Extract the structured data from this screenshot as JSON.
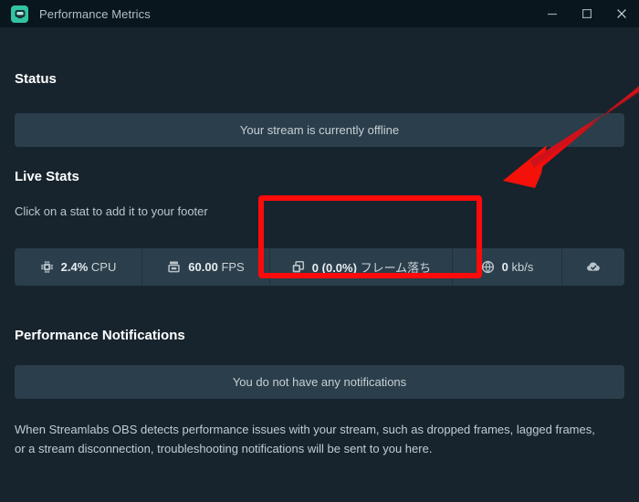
{
  "window": {
    "title": "Performance Metrics",
    "app_icon": "streamlabs-obs-icon",
    "controls": {
      "minimize": "minimize-icon",
      "maximize": "maximize-icon",
      "close": "close-icon"
    }
  },
  "sections": {
    "status": {
      "heading": "Status",
      "message": "Your stream is currently offline"
    },
    "live_stats": {
      "heading": "Live Stats",
      "hint": "Click on a stat to add it to your footer",
      "stats": [
        {
          "icon": "cpu-chip-icon",
          "value": "2.4%",
          "unit": "CPU"
        },
        {
          "icon": "layers-stack-icon",
          "value": "60.00",
          "unit": "FPS"
        },
        {
          "icon": "duplicate-frames-icon",
          "value": "0 (0.0%)",
          "unit": "フレーム落ち"
        },
        {
          "icon": "bandwidth-globe-icon",
          "value": "0",
          "unit": "kb/s"
        },
        {
          "icon": "cloud-check-icon",
          "value": "",
          "unit": ""
        }
      ]
    },
    "notifications": {
      "heading": "Performance Notifications",
      "empty_message": "You do not have any notifications",
      "description": "When Streamlabs OBS detects performance issues with your stream, such as dropped frames, lagged frames, or a stream disconnection, troubleshooting notifications will be sent to you here."
    }
  },
  "annotations": {
    "highlight_box": {
      "target": "dropped-frames-stat",
      "color": "#fd0b0b"
    },
    "arrow": {
      "target": "dropped-frames-stat",
      "color": "#e8140f",
      "direction": "down-left"
    }
  },
  "colors": {
    "window_bg": "#17242d",
    "titlebar_bg": "#09161d",
    "panel_bg": "#2b3e4b",
    "accent_green": "#31c3a2",
    "annotation_red": "#fd0b0b"
  }
}
